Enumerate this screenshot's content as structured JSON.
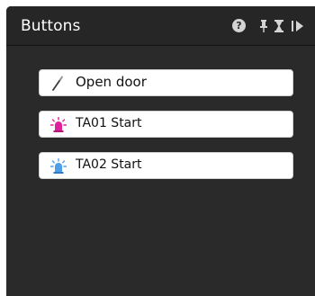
{
  "panel": {
    "title": "Buttons",
    "help_glyph": "?"
  },
  "buttons": [
    {
      "label": "Open door",
      "icon": "wand-icon"
    },
    {
      "label": "TA01 Start",
      "icon": "alarm-light-icon",
      "icon_color": "#e0209a"
    },
    {
      "label": "TA02 Start",
      "icon": "alarm-light-icon",
      "icon_color": "#4d9fe8"
    }
  ],
  "colors": {
    "panel_bg": "#2a2a2a",
    "titlebar_bg": "#262626",
    "button_bg": "#ffffff"
  }
}
